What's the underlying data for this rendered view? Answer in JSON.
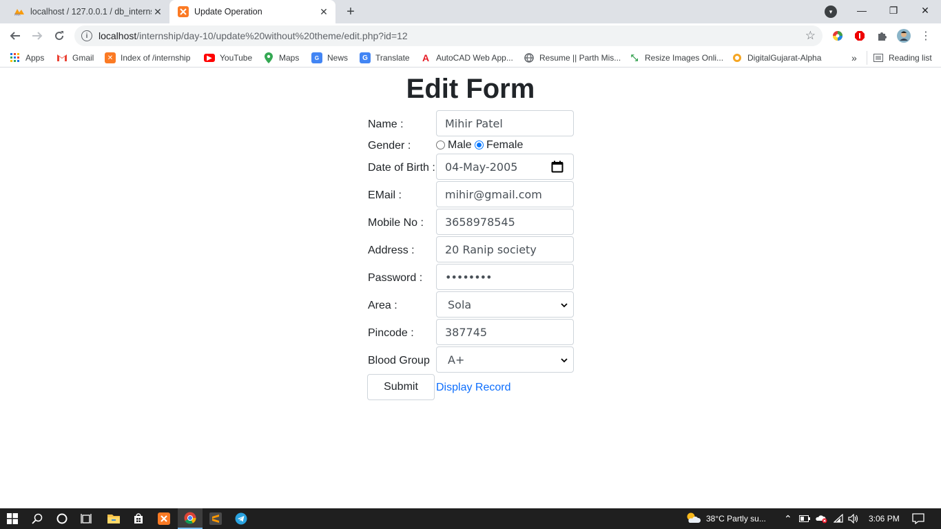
{
  "browser": {
    "tabs": [
      {
        "title": "localhost / 127.0.0.1 / db_internship",
        "favicon": "phpmyadmin-icon",
        "active": false
      },
      {
        "title": "Update Operation",
        "favicon": "xampp-icon",
        "active": true
      }
    ],
    "url": {
      "host": "localhost",
      "path": "/internship/day-10/update%20without%20theme/edit.php?id=12"
    },
    "bookmarks": [
      {
        "label": "Apps",
        "icon": "apps-grid-icon"
      },
      {
        "label": "Gmail",
        "icon": "gmail-icon"
      },
      {
        "label": "Index of /internship",
        "icon": "xampp-icon"
      },
      {
        "label": "YouTube",
        "icon": "youtube-icon"
      },
      {
        "label": "Maps",
        "icon": "maps-icon"
      },
      {
        "label": "News",
        "icon": "news-icon"
      },
      {
        "label": "Translate",
        "icon": "translate-icon"
      },
      {
        "label": "AutoCAD Web App...",
        "icon": "autocad-icon"
      },
      {
        "label": "Resume || Parth Mis...",
        "icon": "globe-icon"
      },
      {
        "label": "Resize Images Onli...",
        "icon": "resize-icon"
      },
      {
        "label": "DigitalGujarat-Alpha",
        "icon": "digitalgujarat-icon"
      }
    ],
    "reading_list": "Reading list"
  },
  "form": {
    "title": "Edit Form",
    "name_label": "Name :",
    "name_value": "Mihir Patel",
    "gender_label": "Gender :",
    "gender_options": [
      "Male",
      "Female"
    ],
    "gender_selected": "Female",
    "dob_label": "Date of Birth :",
    "dob_value": "04-May-2005",
    "email_label": "EMail :",
    "email_value": "mihir@gmail.com",
    "mobile_label": "Mobile No :",
    "mobile_value": "3658978545",
    "address_label": "Address :",
    "address_value": "20 Ranip society",
    "password_label": "Password :",
    "password_value": "••••••••",
    "area_label": "Area :",
    "area_value": "Sola",
    "pincode_label": "Pincode :",
    "pincode_value": "387745",
    "blood_label": "Blood Group",
    "blood_value": "A+",
    "submit_label": "Submit",
    "display_link": "Display Record"
  },
  "taskbar": {
    "weather": "38°C  Partly su...",
    "time": "3:06 PM"
  },
  "colors": {
    "link": "#0d6efd",
    "radio_checked": "#0075ff",
    "tabbar": "#dee1e6",
    "taskbar": "#1f1f1f"
  }
}
